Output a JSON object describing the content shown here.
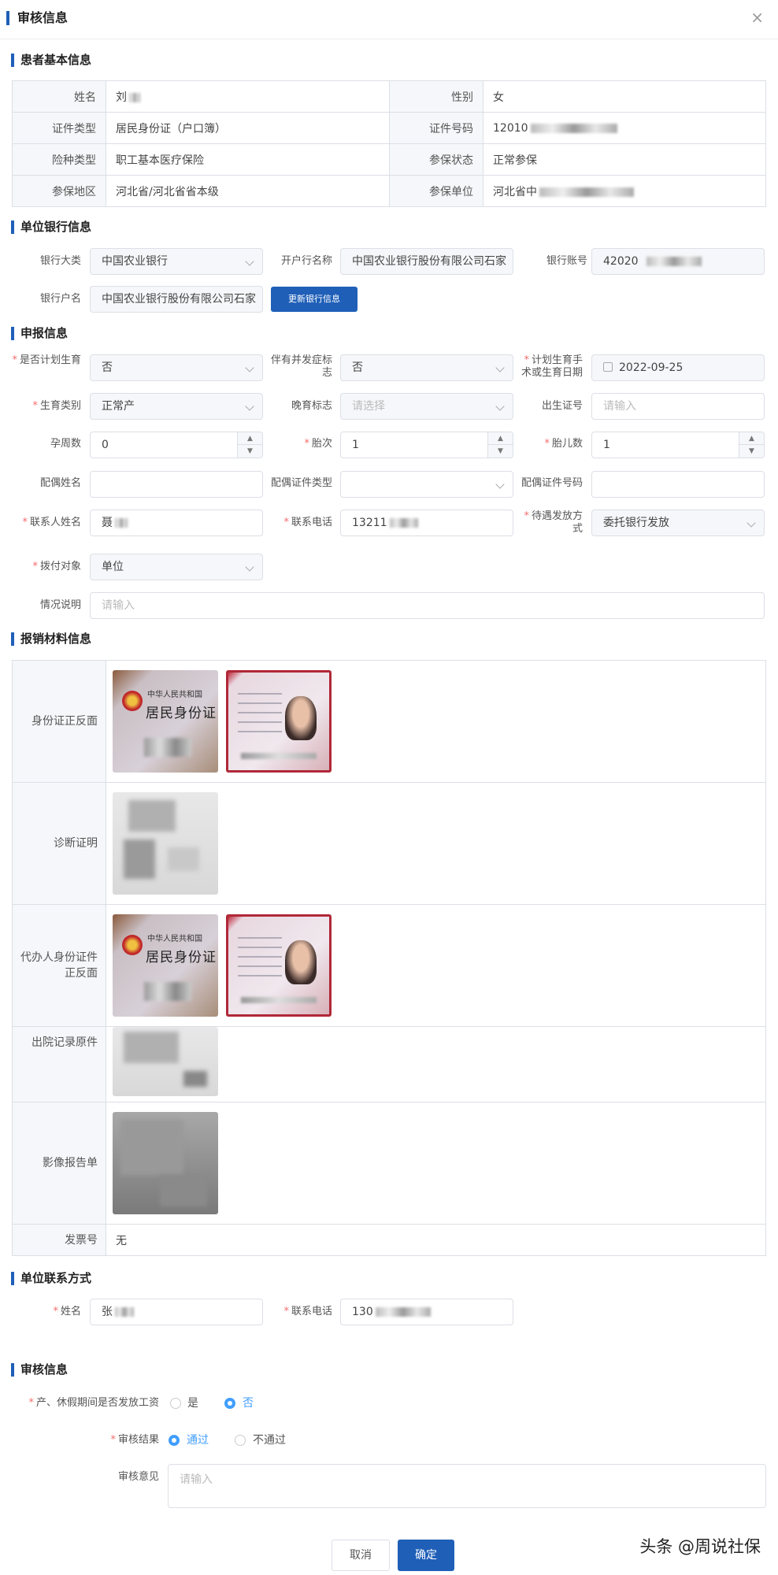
{
  "dialog": {
    "title": "审核信息",
    "close": "×"
  },
  "patient": {
    "section_title": "患者基本信息",
    "rows": [
      {
        "l1": "姓名",
        "v1": "刘",
        "l2": "性别",
        "v2": "女"
      },
      {
        "l1": "证件类型",
        "v1": "居民身份证（户口簿）",
        "l2": "证件号码",
        "v2": "12010"
      },
      {
        "l1": "险种类型",
        "v1": "职工基本医疗保险",
        "l2": "参保状态",
        "v2": "正常参保"
      },
      {
        "l1": "参保地区",
        "v1": "河北省/河北省省本级",
        "l2": "参保单位",
        "v2": "河北省中"
      }
    ]
  },
  "bank": {
    "section_title": "单位银行信息",
    "bank_type_label": "银行大类",
    "bank_type_value": "中国农业银行",
    "branch_label": "开户行名称",
    "branch_value": "中国农业银行股份有限公司石家",
    "account_label": "银行账号",
    "account_value": "42020",
    "holder_label": "银行户名",
    "holder_value": "中国农业银行股份有限公司石家",
    "update_button": "更新银行信息"
  },
  "declare": {
    "section_title": "申报信息",
    "planned_label": "是否计划生育",
    "planned_value": "否",
    "complication_label": "伴有并发症标志",
    "complication_value": "否",
    "date_label": "计划生育手术或生育日期",
    "date_value": "2022-09-25",
    "birth_type_label": "生育类别",
    "birth_type_value": "正常产",
    "late_label": "晚育标志",
    "late_placeholder": "请选择",
    "cert_label": "出生证号",
    "cert_placeholder": "请输入",
    "weeks_label": "孕周数",
    "weeks_value": "0",
    "parity_label": "胎次",
    "parity_value": "1",
    "fetus_label": "胎儿数",
    "fetus_value": "1",
    "spouse_name_label": "配偶姓名",
    "spouse_id_type_label": "配偶证件类型",
    "spouse_id_no_label": "配偶证件号码",
    "contact_name_label": "联系人姓名",
    "contact_name_value": "聂",
    "contact_phone_label": "联系电话",
    "contact_phone_value": "13211",
    "payment_method_label": "待遇发放方式",
    "payment_method_value": "委托银行发放",
    "pay_target_label": "拨付对象",
    "pay_target_value": "单位",
    "remark_label": "情况说明",
    "remark_placeholder": "请输入"
  },
  "materials": {
    "section_title": "报销材料信息",
    "rows": [
      {
        "label": "身份证正反面"
      },
      {
        "label": "诊断证明"
      },
      {
        "label": "代办人身份证件正反面"
      },
      {
        "label": "出院记录原件"
      },
      {
        "label": "影像报告单"
      }
    ],
    "id_card_title_small": "中华人民共和国",
    "id_card_title_big": "居民身份证",
    "invoice_label": "发票号",
    "invoice_value": "无"
  },
  "unit_contact": {
    "section_title": "单位联系方式",
    "name_label": "姓名",
    "name_value": "张",
    "phone_label": "联系电话",
    "phone_value": "130"
  },
  "review": {
    "section_title": "审核信息",
    "salary_label": "产、休假期间是否发放工资",
    "salary_yes": "是",
    "salary_no": "否",
    "result_label": "审核结果",
    "result_pass": "通过",
    "result_fail": "不通过",
    "opinion_label": "审核意见",
    "opinion_placeholder": "请输入",
    "cancel_button": "取消",
    "confirm_button": "确定"
  },
  "watermark": "头条 @周说社保",
  "colors": {
    "accent": "#1f5fb8",
    "required": "#f56c6c",
    "radio_active": "#409eff"
  }
}
